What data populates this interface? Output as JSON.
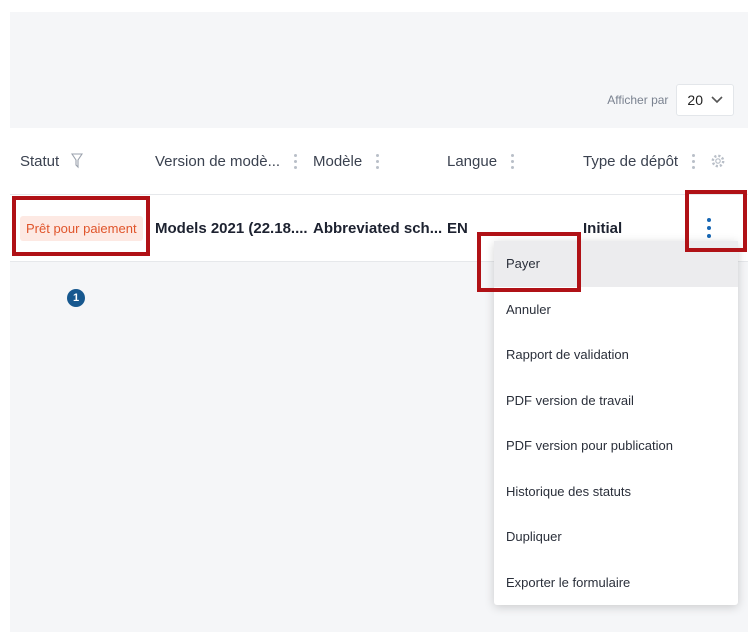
{
  "pagination": {
    "label": "Afficher par",
    "page_size": "20"
  },
  "table": {
    "columns": [
      {
        "label": "Statut"
      },
      {
        "label": "Version de modè..."
      },
      {
        "label": "Modèle"
      },
      {
        "label": "Langue"
      },
      {
        "label": "Type de dépôt"
      }
    ],
    "row": {
      "status": "Prêt pour paiement",
      "version": "Models 2021 (22.18....",
      "model": "Abbreviated sch...",
      "language": "EN",
      "filing_type": "Initial"
    }
  },
  "step_marker": "1",
  "context_menu": {
    "items": [
      "Payer",
      "Annuler",
      "Rapport de validation",
      "PDF version de travail",
      "PDF version pour publication",
      "Historique des statuts",
      "Dupliquer",
      "Exporter le formulaire"
    ]
  },
  "colors": {
    "highlight": "#b01116",
    "status_text": "#e0552b",
    "status_bg": "#fde9e3",
    "accent": "#1767b4"
  },
  "icons": {
    "filter": "filter-icon",
    "chevron": "chevron-down-icon",
    "gear": "gear-icon",
    "kebab": "kebab-menu-icon"
  }
}
